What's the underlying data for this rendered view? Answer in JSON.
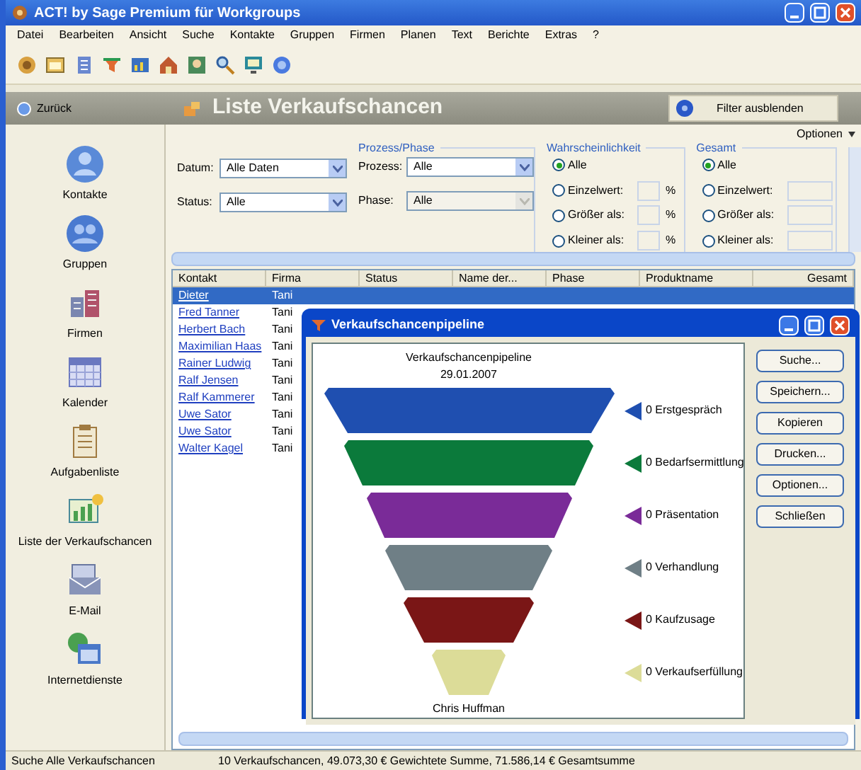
{
  "window": {
    "title": "ACT! by Sage Premium für Workgroups"
  },
  "menu": [
    "Datei",
    "Bearbeiten",
    "Ansicht",
    "Suche",
    "Kontakte",
    "Gruppen",
    "Firmen",
    "Planen",
    "Text",
    "Berichte",
    "Extras",
    "?"
  ],
  "nav": {
    "back": "Zurück",
    "title": "Liste Verkaufschancen",
    "filter_button": "Filter ausblenden"
  },
  "sidebar": {
    "items": [
      {
        "label": "Kontakte",
        "kind": "contact"
      },
      {
        "label": "Gruppen",
        "kind": "group"
      },
      {
        "label": "Firmen",
        "kind": "company"
      },
      {
        "label": "Kalender",
        "kind": "calendar"
      },
      {
        "label": "Aufgabenliste",
        "kind": "tasks"
      },
      {
        "label": "Liste der Verkaufschancen",
        "kind": "opportunities"
      },
      {
        "label": "E-Mail",
        "kind": "email"
      },
      {
        "label": "Internetdienste",
        "kind": "internet"
      }
    ]
  },
  "options_label": "Optionen",
  "filters": {
    "date": {
      "label": "Datum:",
      "value": "Alle Daten"
    },
    "status": {
      "label": "Status:",
      "value": "Alle"
    },
    "process_group": {
      "title": "Prozess/Phase",
      "process": {
        "label": "Prozess:",
        "value": "Alle",
        "disabled": false
      },
      "phase": {
        "label": "Phase:",
        "value": "Alle",
        "disabled": true
      }
    },
    "probability": {
      "title": "Wahrscheinlichkeit",
      "options": [
        {
          "label": "Alle",
          "selected": true
        },
        {
          "label": "Einzelwert:",
          "selected": false,
          "unit": "%"
        },
        {
          "label": "Größer als:",
          "selected": false,
          "unit": "%"
        },
        {
          "label": "Kleiner als:",
          "selected": false,
          "unit": "%"
        }
      ]
    },
    "total": {
      "title": "Gesamt",
      "options": [
        {
          "label": "Alle",
          "selected": true
        },
        {
          "label": "Einzelwert:",
          "selected": false
        },
        {
          "label": "Größer als:",
          "selected": false
        },
        {
          "label": "Kleiner als:",
          "selected": false
        }
      ]
    }
  },
  "table": {
    "columns": [
      "Kontakt",
      "Firma",
      "Status",
      "Name der...",
      "Phase",
      "Produktname",
      "Gesamt"
    ],
    "rows": [
      {
        "contact": "Dieter",
        "company": "Tani",
        "selected": true
      },
      {
        "contact": "Fred Tanner",
        "company": "Tani",
        "selected": false
      },
      {
        "contact": "Herbert Bach",
        "company": "Tani",
        "selected": false
      },
      {
        "contact": "Maximilian Haas",
        "company": "Tani",
        "selected": false
      },
      {
        "contact": "Rainer Ludwig",
        "company": "Tani",
        "selected": false
      },
      {
        "contact": "Ralf Jensen",
        "company": "Tani",
        "selected": false
      },
      {
        "contact": "Ralf Kammerer",
        "company": "Tani",
        "selected": false
      },
      {
        "contact": "Uwe Sator",
        "company": "Tani",
        "selected": false
      },
      {
        "contact": "Uwe Sator",
        "company": "Tani",
        "selected": false
      },
      {
        "contact": "Walter Kagel",
        "company": "Tani",
        "selected": false
      }
    ]
  },
  "dialog": {
    "title": "Verkaufschancenpipeline",
    "chart_title": "Verkaufschancenpipeline",
    "date": "29.01.2007",
    "owner": "Chris Huffman",
    "stages": [
      {
        "label": "0 Erstgespräch",
        "color": "#1f4fb0"
      },
      {
        "label": "0 Bedarfsermittlung",
        "color": "#0b7a3b"
      },
      {
        "label": "0 Präsentation",
        "color": "#7a2b98"
      },
      {
        "label": "0 Verhandlung",
        "color": "#6f7f86"
      },
      {
        "label": "0 Kaufzusage",
        "color": "#7a1616"
      },
      {
        "label": "0 Verkaufserfüllung",
        "color": "#dcdc98"
      }
    ],
    "buttons": [
      "Suche...",
      "Speichern...",
      "Kopieren",
      "Drucken...",
      "Optionen...",
      "Schließen"
    ]
  },
  "status_bar": [
    "Suche Alle Verkaufschancen",
    "10 Verkaufschancen, 49.073,30 € Gewichtete Summe, 71.586,14 € Gesamtsumme"
  ]
}
